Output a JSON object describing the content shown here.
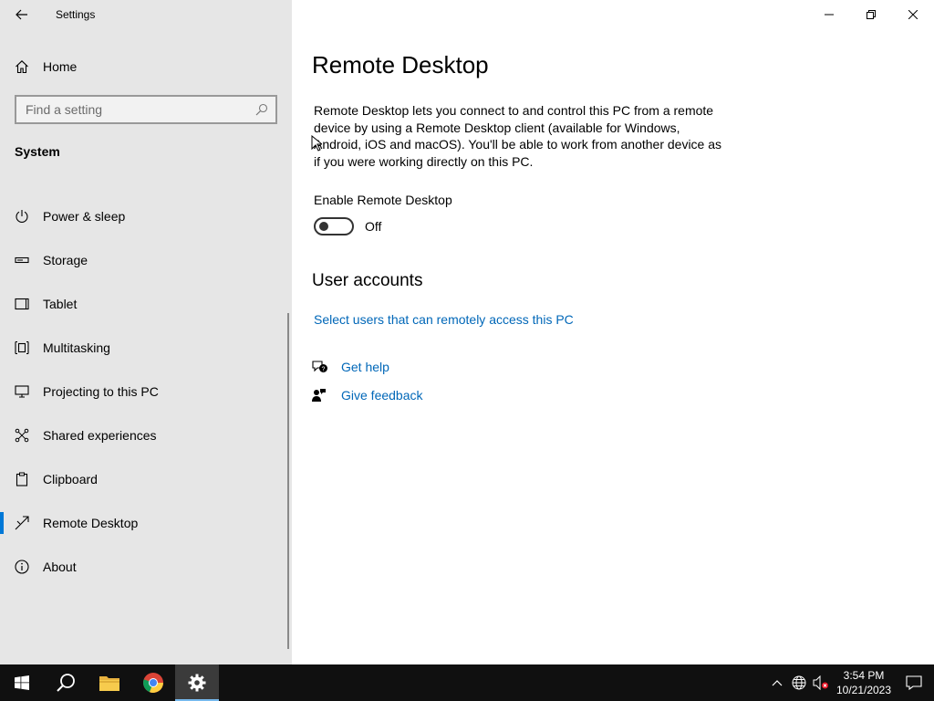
{
  "window": {
    "title": "Settings"
  },
  "sidebar": {
    "home_label": "Home",
    "search_placeholder": "Find a setting",
    "section_title": "System",
    "items": [
      {
        "label": "Power & sleep",
        "icon": "power-icon"
      },
      {
        "label": "Storage",
        "icon": "storage-icon"
      },
      {
        "label": "Tablet",
        "icon": "tablet-icon"
      },
      {
        "label": "Multitasking",
        "icon": "multitasking-icon"
      },
      {
        "label": "Projecting to this PC",
        "icon": "projecting-icon"
      },
      {
        "label": "Shared experiences",
        "icon": "shared-experiences-icon"
      },
      {
        "label": "Clipboard",
        "icon": "clipboard-icon"
      },
      {
        "label": "Remote Desktop",
        "icon": "remote-desktop-icon",
        "selected": true
      },
      {
        "label": "About",
        "icon": "info-icon"
      }
    ]
  },
  "main": {
    "title": "Remote Desktop",
    "description": "Remote Desktop lets you connect to and control this PC from a remote device by using a Remote Desktop client (available for Windows, Android, iOS and macOS). You'll be able to work from another device as if you were working directly on this PC.",
    "toggle_label": "Enable Remote Desktop",
    "toggle_state": "Off",
    "user_accounts_heading": "User accounts",
    "select_users_link": "Select users that can remotely access this PC",
    "get_help": "Get help",
    "give_feedback": "Give feedback"
  },
  "taskbar": {
    "time": "3:54 PM",
    "date": "10/21/2023",
    "apps": [
      "start-icon",
      "search-icon",
      "file-explorer-icon",
      "chrome-icon",
      "settings-icon"
    ]
  },
  "colors": {
    "accent": "#0078d7",
    "link": "#0067b8",
    "sidebar_bg": "#e6e6e6",
    "taskbar_bg": "#101010"
  }
}
